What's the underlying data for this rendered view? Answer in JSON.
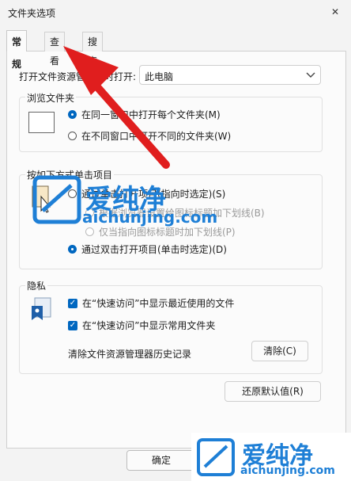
{
  "window": {
    "title": "文件夹选项",
    "close_symbol": "✕"
  },
  "tabs": [
    {
      "label": "常规",
      "active": true
    },
    {
      "label": "查看",
      "active": false
    },
    {
      "label": "搜索",
      "active": false
    }
  ],
  "open_in": {
    "label": "打开文件资源管理器时打开:",
    "value": "此电脑"
  },
  "browse": {
    "legend": "浏览文件夹",
    "options": [
      {
        "label": "在同一窗口中打开每个文件夹(M)",
        "selected": true
      },
      {
        "label": "在不同窗口中打开不同的文件夹(W)",
        "selected": false
      }
    ]
  },
  "click": {
    "legend": "按如下方式单击项目",
    "options": [
      {
        "label": "通过单击打开项目(指向时选定)(S)",
        "selected": false,
        "disabled": false
      },
      {
        "label": "根据浏览器设置给图标标题加下划线(B)",
        "selected": false,
        "disabled": true
      },
      {
        "label": "仅当指向图标标题时加下划线(P)",
        "selected": false,
        "disabled": true
      },
      {
        "label": "通过双击打开项目(单击时选定)(D)",
        "selected": true,
        "disabled": false
      }
    ]
  },
  "privacy": {
    "legend": "隐私",
    "checks": [
      {
        "label": "在“快速访问”中显示最近使用的文件",
        "checked": true
      },
      {
        "label": "在“快速访问”中显示常用文件夹",
        "checked": true
      }
    ],
    "clear_label": "清除文件资源管理器历史记录",
    "clear_button": "清除(C)"
  },
  "restore_button": "还原默认值(R)",
  "ok_button": "确定",
  "watermark": {
    "text_cn": "爱纯净",
    "url": "aichunjing.com"
  },
  "colors": {
    "accent": "#0067c0",
    "arrow": "#e01e1e",
    "watermark": "#1e7fd6"
  }
}
